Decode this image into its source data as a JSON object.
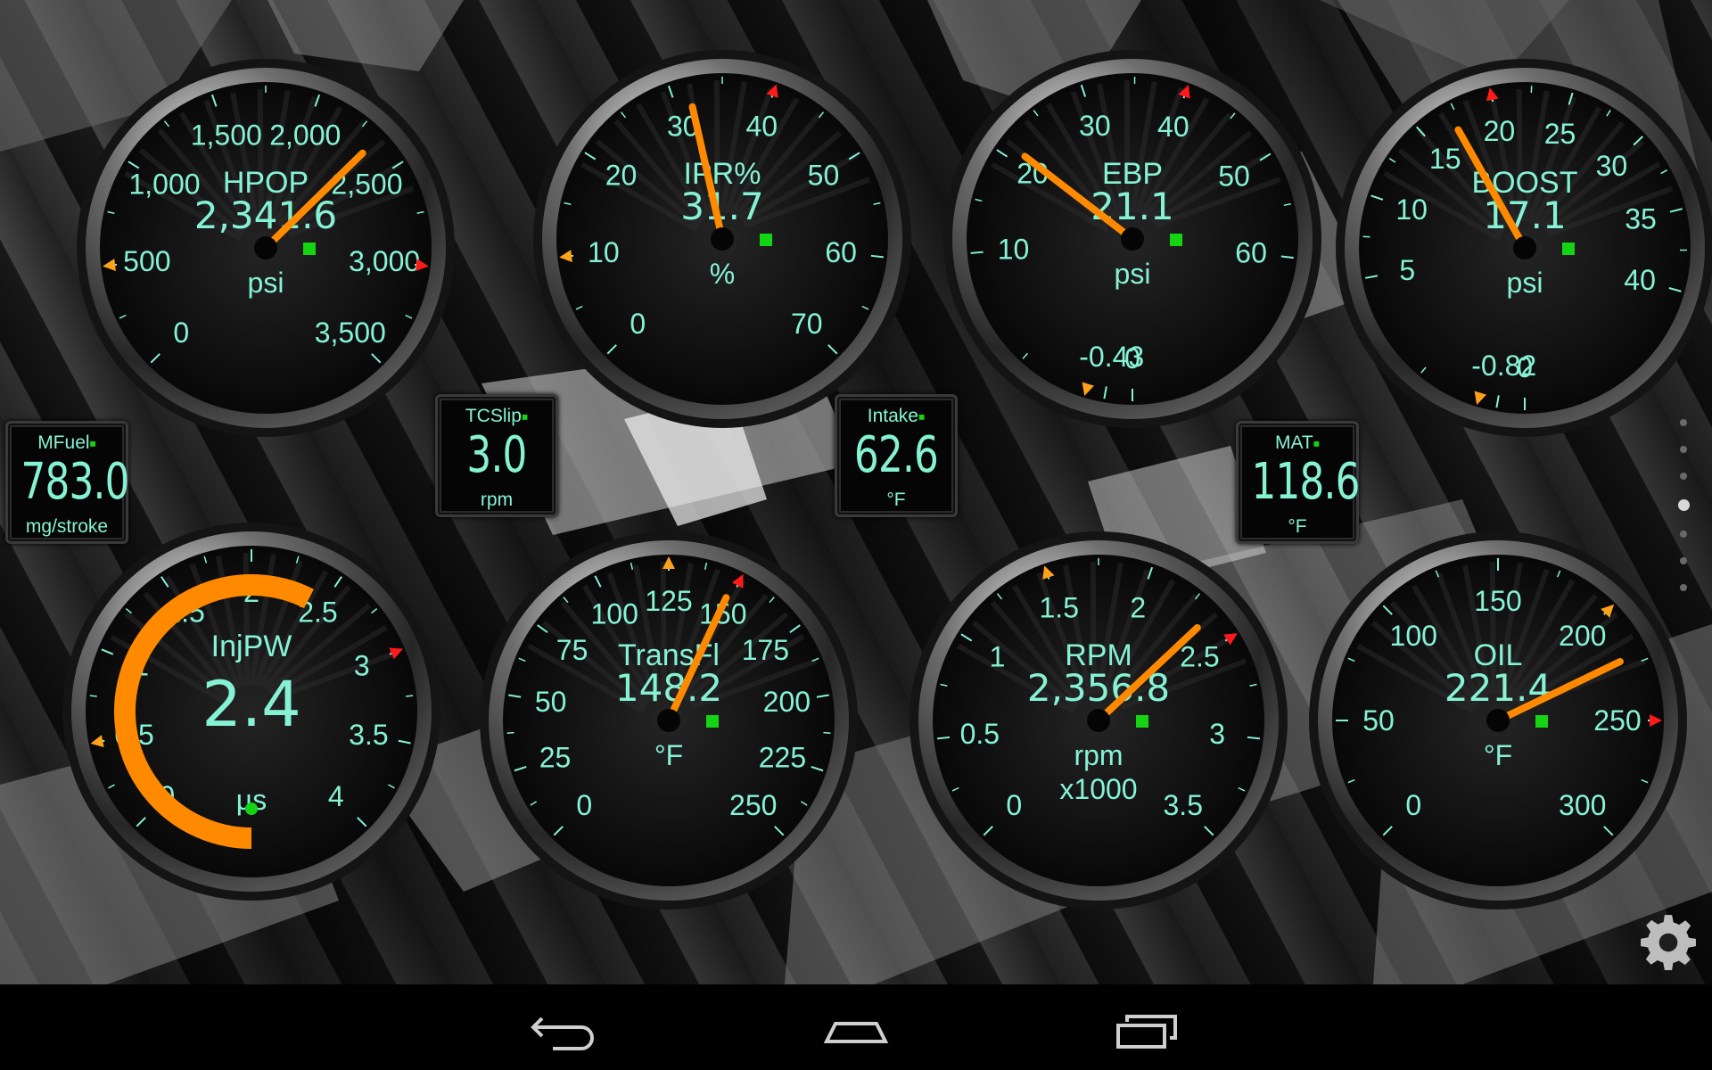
{
  "colors": {
    "scale_text": "#86f2d4",
    "needle": "#ff8a00",
    "alarm_high": "#ff1a1a",
    "alarm_low": "#ffa21a",
    "status_green": "#14d414",
    "arc_fill": "#ff8a00"
  },
  "gauges": [
    {
      "id": "hpop",
      "title": "HPOP",
      "value_text": "2,341.6",
      "unit": "psi",
      "value": 2341.6,
      "min": 0,
      "max": 3500,
      "ticks": [
        "0",
        "500",
        "1,000",
        "1,500",
        "2,000",
        "2,500",
        "3,000",
        "3,500"
      ],
      "alarm_high": 3000,
      "alarm_low": 500
    },
    {
      "id": "ipr",
      "title": "IPR%",
      "value_text": "31.7",
      "unit": "%",
      "value": 31.7,
      "min": 0,
      "max": 70,
      "ticks": [
        "0",
        "10",
        "20",
        "30",
        "40",
        "50",
        "60",
        "70"
      ],
      "alarm_high": 40,
      "alarm_low": 10
    },
    {
      "id": "ebp",
      "title": "EBP",
      "value_text": "21.1",
      "unit": "psi",
      "value": 21.1,
      "min": -0.43,
      "max": 70,
      "ticks": [
        "0",
        "10",
        "20",
        "30",
        "40",
        "50",
        "60",
        "-0.43"
      ],
      "alarm_high": 40,
      "alarm_low": -0.43
    },
    {
      "id": "boost",
      "title": "BOOST",
      "value_text": "17.1",
      "unit": "psi",
      "value": 17.1,
      "min": -0.82,
      "max": 45,
      "ticks": [
        "0",
        "5",
        "10",
        "15",
        "20",
        "25",
        "30",
        "35",
        "40",
        "-0.82"
      ],
      "alarm_high": 20,
      "alarm_low": -0.82
    },
    {
      "id": "injpw",
      "title": "InjPW",
      "value_text": "2.4",
      "unit": "µs",
      "value": 2.4,
      "min": 0,
      "max": 4,
      "ticks": [
        "0",
        "0.5",
        "1",
        "1.5",
        "2",
        "2.5",
        "3",
        "3.5",
        "4"
      ],
      "alarm_high": 3,
      "alarm_low": 0.5
    },
    {
      "id": "transfl",
      "title": "TransFl",
      "value_text": "148.2",
      "unit": "°F",
      "value": 148.2,
      "min": 0,
      "max": 250,
      "ticks": [
        "0",
        "25",
        "50",
        "75",
        "100",
        "125",
        "150",
        "175",
        "200",
        "225",
        "250"
      ],
      "alarm_high": 150,
      "alarm_low": 125
    },
    {
      "id": "rpm",
      "title": "RPM",
      "value_text": "2,356.8",
      "unit": "rpm",
      "unit2": "x1000",
      "value": 2.3568,
      "min": 0,
      "max": 3.5,
      "ticks": [
        "0",
        "0.5",
        "1",
        "1.5",
        "2",
        "2.5",
        "3",
        "3.5"
      ],
      "alarm_high": 2.5,
      "alarm_low": 1.5
    },
    {
      "id": "oil",
      "title": "OIL",
      "value_text": "221.4",
      "unit": "°F",
      "value": 221.4,
      "min": 0,
      "max": 300,
      "ticks": [
        "0",
        "50",
        "100",
        "150",
        "200",
        "250",
        "300"
      ],
      "alarm_high": 250,
      "alarm_low": 200
    }
  ],
  "readouts": [
    {
      "id": "mfuel",
      "label": "MFuel",
      "value": "783.0",
      "unit": "mg/stroke"
    },
    {
      "id": "tcslip",
      "label": "TCSlip",
      "value": "3.0",
      "unit": "rpm"
    },
    {
      "id": "intake",
      "label": "Intake",
      "value": "62.6",
      "unit": "°F"
    },
    {
      "id": "mat",
      "label": "MAT",
      "value": "118.6",
      "unit": "°F"
    }
  ],
  "pager": {
    "count": 7,
    "active_index": 3
  },
  "icons": {
    "settings": "gear-icon",
    "nav_back": "back-icon",
    "nav_home": "home-icon",
    "nav_recents": "recent-apps-icon"
  }
}
